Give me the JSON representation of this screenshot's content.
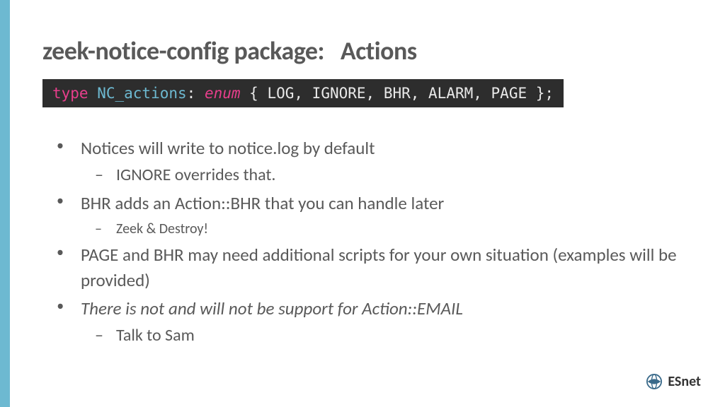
{
  "title": "zeek-notice-config package:   Actions",
  "code": {
    "type": "type ",
    "name": "NC_actions",
    "colon": ": ",
    "enum": "enum",
    "body": " { LOG, IGNORE, BHR, ALARM, PAGE };"
  },
  "bullets": [
    {
      "text": "Notices will write to notice.log by default",
      "sub": [
        {
          "text": "IGNORE overrides that.",
          "small": false
        }
      ]
    },
    {
      "text": "BHR adds an Action::BHR that you can handle later",
      "sub": [
        {
          "text": "Zeek & Destroy!",
          "small": true
        }
      ]
    },
    {
      "text": "PAGE and BHR may need additional scripts for your own situation (examples will be provided)",
      "sub": []
    },
    {
      "text": "There is not and will not be support for Action::EMAIL",
      "italic": true,
      "sub": [
        {
          "text": "Talk to Sam",
          "small": false
        }
      ]
    }
  ],
  "logo": {
    "text": "ESnet"
  }
}
